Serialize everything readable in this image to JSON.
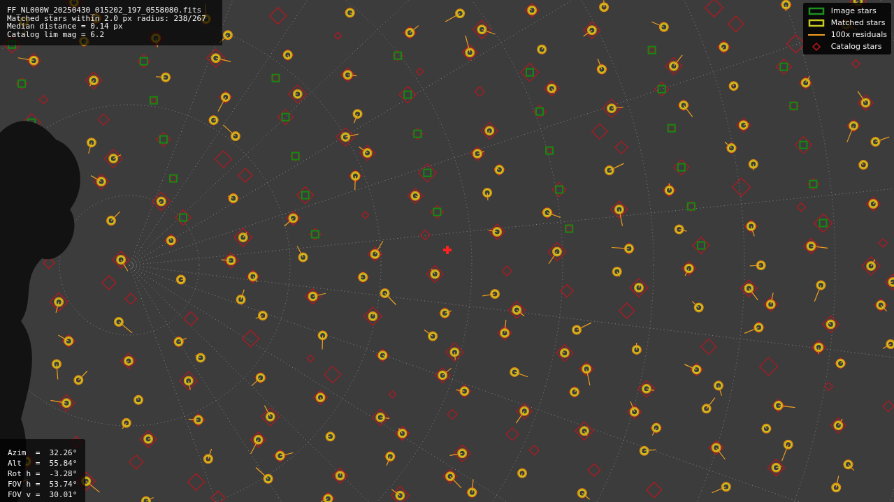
{
  "info_box": {
    "lines": [
      "FF_NL000W_20250430_015202_197_0558080.fits",
      "Matched stars within 2.0 px radius: 238/267",
      "Median distance = 0.14 px",
      "Catalog lim mag = 6.2"
    ]
  },
  "legend": {
    "items": [
      {
        "kind": "box",
        "label": "Image stars",
        "color": "#1f8f1f"
      },
      {
        "kind": "box",
        "label": "Matched stars",
        "color": "#c8c820"
      },
      {
        "kind": "line",
        "label": "100x residuals",
        "color": "#f0a020"
      },
      {
        "kind": "diamond",
        "label": "Catalog stars",
        "color": "#c01818"
      }
    ]
  },
  "readout": {
    "lines": [
      "Azim  =  32.26°",
      "Alt   =  55.84°",
      "Rot h =  -3.28°",
      "FOV h =  53.74°",
      "FOV v =  30.01°"
    ]
  }
}
